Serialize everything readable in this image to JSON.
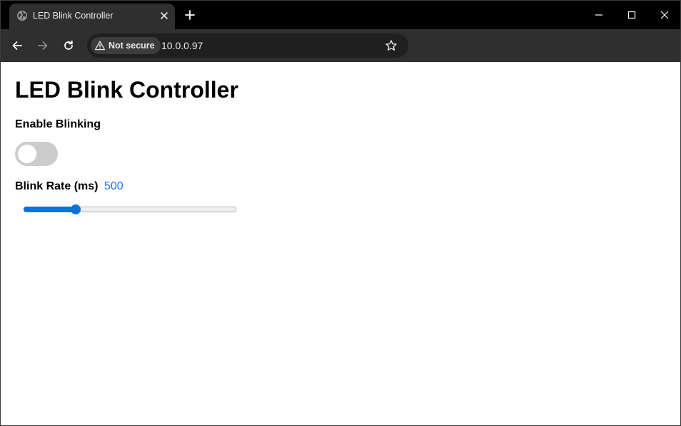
{
  "browser": {
    "tab": {
      "title": "LED Blink Controller",
      "favicon": "globe-icon"
    },
    "new_tab_icon": "plus-icon",
    "window_controls": [
      "minimize-icon",
      "maximize-icon",
      "close-icon"
    ],
    "nav": [
      "back-arrow-icon",
      "forward-arrow-icon",
      "reload-icon"
    ],
    "security_label": "Not secure",
    "url": "10.0.0.97",
    "bookmark_icon": "star-icon"
  },
  "page": {
    "title": "LED Blink Controller",
    "enable_label": "Enable Blinking",
    "toggle_on": false,
    "rate_label": "Blink Rate (ms)",
    "rate_value": "500",
    "slider": {
      "value": 500,
      "fraction": 0.245
    }
  },
  "colors": {
    "accent": "#0b74d6",
    "rate_value_text": "#1a73e8",
    "toggle_off": "#cccccc",
    "browser_dark": "#2f2f2f"
  }
}
